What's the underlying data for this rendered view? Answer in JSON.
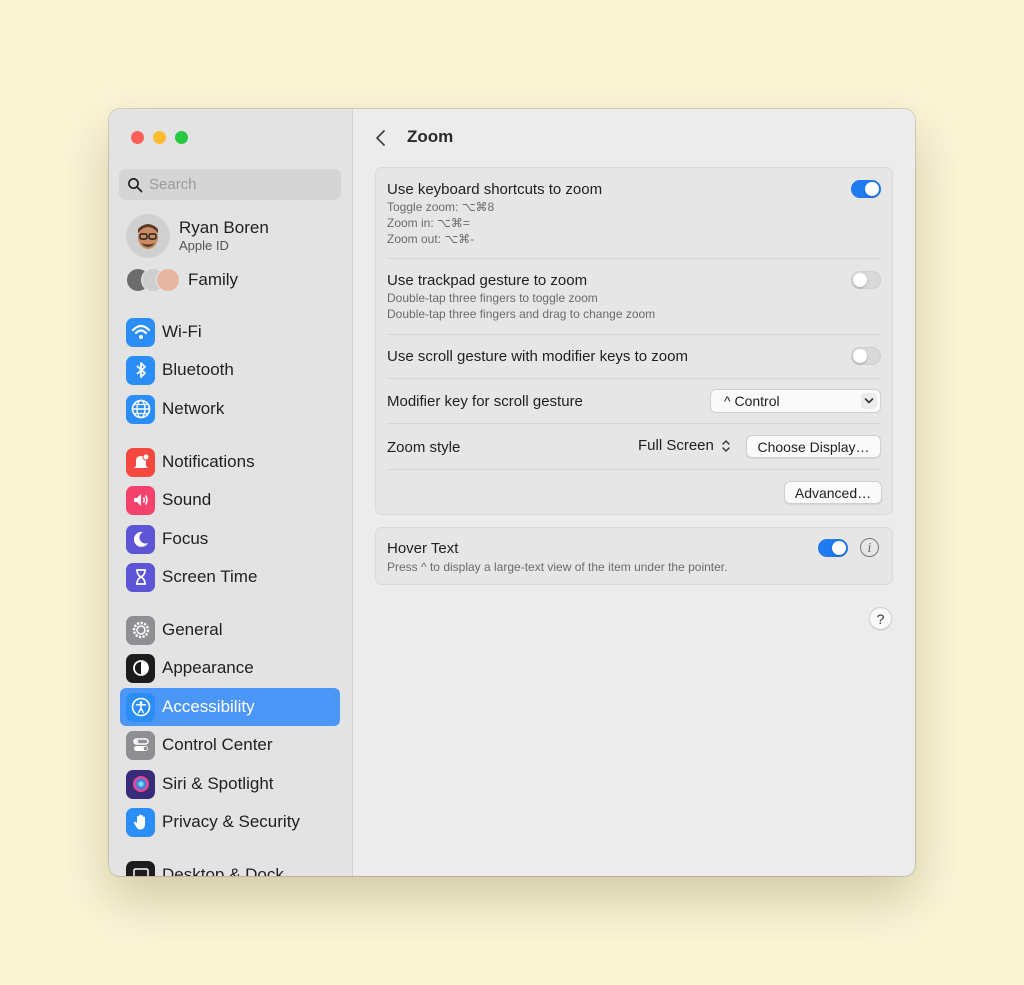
{
  "window": {
    "title": "Zoom"
  },
  "sidebar": {
    "search_placeholder": "Search",
    "profile": {
      "name": "Ryan Boren",
      "subtitle": "Apple ID"
    },
    "family_label": "Family",
    "items": [
      {
        "label": "Wi-Fi",
        "icon": "wifi-icon",
        "color": "#2b8ef6"
      },
      {
        "label": "Bluetooth",
        "icon": "bluetooth-icon",
        "color": "#2b8ef6"
      },
      {
        "label": "Network",
        "icon": "globe-icon",
        "color": "#2b8ef6"
      },
      {
        "label": "Notifications",
        "icon": "bell-icon",
        "color": "#f5483e"
      },
      {
        "label": "Sound",
        "icon": "speaker-icon",
        "color": "#f5426d"
      },
      {
        "label": "Focus",
        "icon": "moon-icon",
        "color": "#5d55d6"
      },
      {
        "label": "Screen Time",
        "icon": "hourglass-icon",
        "color": "#5d55d6"
      },
      {
        "label": "General",
        "icon": "gear-icon",
        "color": "#8e8e93"
      },
      {
        "label": "Appearance",
        "icon": "appearance-icon",
        "color": "#1c1c1e"
      },
      {
        "label": "Accessibility",
        "icon": "accessibility-icon",
        "color": "#2b8ef6",
        "active": true
      },
      {
        "label": "Control Center",
        "icon": "toggles-icon",
        "color": "#8e8e93"
      },
      {
        "label": "Siri & Spotlight",
        "icon": "siri-icon",
        "color": "#3a2b7a"
      },
      {
        "label": "Privacy & Security",
        "icon": "hand-icon",
        "color": "#2b8ef6"
      },
      {
        "label": "Desktop & Dock",
        "icon": "dock-icon",
        "color": "#1c1c1e"
      }
    ]
  },
  "main": {
    "keyboard": {
      "title": "Use keyboard shortcuts to zoom",
      "lines": [
        "Toggle zoom: ⌥⌘8",
        "Zoom in: ⌥⌘=",
        "Zoom out: ⌥⌘-"
      ],
      "enabled": true
    },
    "trackpad": {
      "title": "Use trackpad gesture to zoom",
      "lines": [
        "Double-tap three fingers to toggle zoom",
        "Double-tap three fingers and drag to change zoom"
      ],
      "enabled": false
    },
    "scroll": {
      "title": "Use scroll gesture with modifier keys to zoom",
      "enabled": false
    },
    "modifier": {
      "title": "Modifier key for scroll gesture",
      "value": "^ Control"
    },
    "zoom_style": {
      "title": "Zoom style",
      "value": "Full Screen",
      "button": "Choose Display…"
    },
    "advanced_button": "Advanced…",
    "hover_text": {
      "title": "Hover Text",
      "subtitle": "Press ^ to display a large-text view of the item under the pointer.",
      "enabled": true
    },
    "help_label": "?"
  }
}
